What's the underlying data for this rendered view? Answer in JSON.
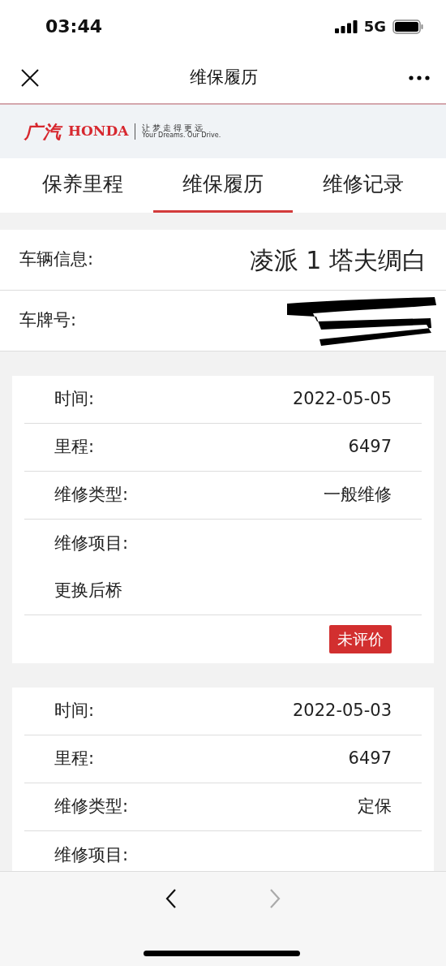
{
  "status_bar": {
    "time": "03:44",
    "network": "5G"
  },
  "header": {
    "title": "维保履历"
  },
  "banner": {
    "brand_cn": "广汽",
    "brand_en": "HONDA",
    "slogan_cn": "让梦走得更远",
    "slogan_en": "Your Dreams. Our Drive."
  },
  "tabs": [
    {
      "label": "保养里程",
      "selected": false
    },
    {
      "label": "维保履历",
      "selected": true
    },
    {
      "label": "维修记录",
      "selected": false
    }
  ],
  "vehicle": [
    {
      "label": "车辆信息:",
      "value": "凌派 1 塔夫绸白",
      "redacted": false
    },
    {
      "label": "车牌号:",
      "redacted": true
    }
  ],
  "records": [
    {
      "rows": [
        {
          "kind": "pair",
          "label": "时间:",
          "value": "2022-05-05"
        },
        {
          "kind": "pair",
          "label": "里程:",
          "value": "6497"
        },
        {
          "kind": "pair",
          "label": "维修类型:",
          "value": "一般维修"
        },
        {
          "kind": "heading",
          "label": "维修项目:"
        },
        {
          "kind": "text",
          "label": "更换后桥"
        },
        {
          "kind": "badge",
          "label": "未评价"
        }
      ]
    },
    {
      "rows": [
        {
          "kind": "pair",
          "label": "时间:",
          "value": "2022-05-03"
        },
        {
          "kind": "pair",
          "label": "里程:",
          "value": "6497"
        },
        {
          "kind": "pair",
          "label": "维修类型:",
          "value": "定保"
        },
        {
          "kind": "heading",
          "label": "维修项目:"
        }
      ]
    }
  ],
  "bottom_nav": {
    "back_disabled": false,
    "forward_disabled": true
  }
}
